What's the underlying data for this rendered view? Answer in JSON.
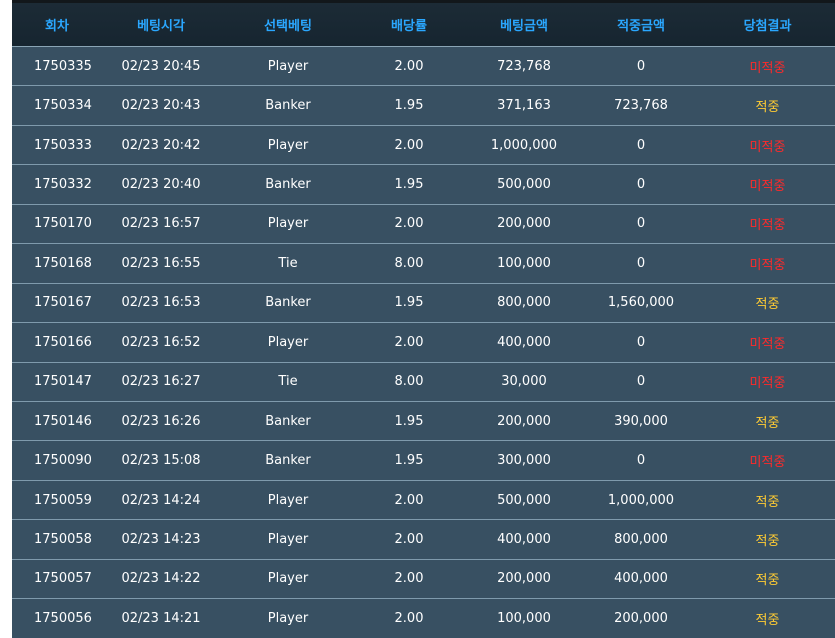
{
  "colors": {
    "header_text": "#2aa7ff",
    "row_bg": "#385062",
    "win": "#ffcc33",
    "lose": "#ff2a2a"
  },
  "table": {
    "headers": [
      "회차",
      "베팅시각",
      "선택베팅",
      "배당률",
      "베팅금액",
      "적중금액",
      "당첨결과"
    ],
    "rows": [
      [
        "1750335",
        "02/23 20:45",
        "Player",
        "2.00",
        "723,768",
        "0",
        "미적중"
      ],
      [
        "1750334",
        "02/23 20:43",
        "Banker",
        "1.95",
        "371,163",
        "723,768",
        "적중"
      ],
      [
        "1750333",
        "02/23 20:42",
        "Player",
        "2.00",
        "1,000,000",
        "0",
        "미적중"
      ],
      [
        "1750332",
        "02/23 20:40",
        "Banker",
        "1.95",
        "500,000",
        "0",
        "미적중"
      ],
      [
        "1750170",
        "02/23 16:57",
        "Player",
        "2.00",
        "200,000",
        "0",
        "미적중"
      ],
      [
        "1750168",
        "02/23 16:55",
        "Tie",
        "8.00",
        "100,000",
        "0",
        "미적중"
      ],
      [
        "1750167",
        "02/23 16:53",
        "Banker",
        "1.95",
        "800,000",
        "1,560,000",
        "적중"
      ],
      [
        "1750166",
        "02/23 16:52",
        "Player",
        "2.00",
        "400,000",
        "0",
        "미적중"
      ],
      [
        "1750147",
        "02/23 16:27",
        "Tie",
        "8.00",
        "30,000",
        "0",
        "미적중"
      ],
      [
        "1750146",
        "02/23 16:26",
        "Banker",
        "1.95",
        "200,000",
        "390,000",
        "적중"
      ],
      [
        "1750090",
        "02/23 15:08",
        "Banker",
        "1.95",
        "300,000",
        "0",
        "미적중"
      ],
      [
        "1750059",
        "02/23 14:24",
        "Player",
        "2.00",
        "500,000",
        "1,000,000",
        "적중"
      ],
      [
        "1750058",
        "02/23 14:23",
        "Player",
        "2.00",
        "400,000",
        "800,000",
        "적중"
      ],
      [
        "1750057",
        "02/23 14:22",
        "Player",
        "2.00",
        "200,000",
        "400,000",
        "적중"
      ],
      [
        "1750056",
        "02/23 14:21",
        "Player",
        "2.00",
        "100,000",
        "200,000",
        "적중"
      ]
    ]
  }
}
